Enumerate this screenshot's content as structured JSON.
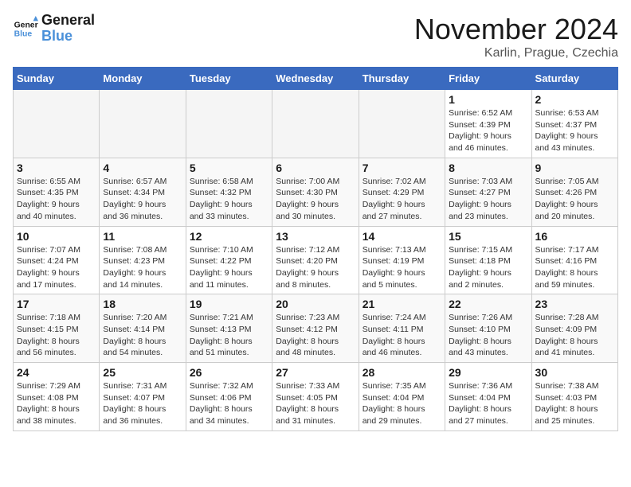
{
  "logo": {
    "line1": "General",
    "line2": "Blue"
  },
  "title": "November 2024",
  "location": "Karlin, Prague, Czechia",
  "weekdays": [
    "Sunday",
    "Monday",
    "Tuesday",
    "Wednesday",
    "Thursday",
    "Friday",
    "Saturday"
  ],
  "weeks": [
    [
      {
        "day": "",
        "info": ""
      },
      {
        "day": "",
        "info": ""
      },
      {
        "day": "",
        "info": ""
      },
      {
        "day": "",
        "info": ""
      },
      {
        "day": "",
        "info": ""
      },
      {
        "day": "1",
        "info": "Sunrise: 6:52 AM\nSunset: 4:39 PM\nDaylight: 9 hours\nand 46 minutes."
      },
      {
        "day": "2",
        "info": "Sunrise: 6:53 AM\nSunset: 4:37 PM\nDaylight: 9 hours\nand 43 minutes."
      }
    ],
    [
      {
        "day": "3",
        "info": "Sunrise: 6:55 AM\nSunset: 4:35 PM\nDaylight: 9 hours\nand 40 minutes."
      },
      {
        "day": "4",
        "info": "Sunrise: 6:57 AM\nSunset: 4:34 PM\nDaylight: 9 hours\nand 36 minutes."
      },
      {
        "day": "5",
        "info": "Sunrise: 6:58 AM\nSunset: 4:32 PM\nDaylight: 9 hours\nand 33 minutes."
      },
      {
        "day": "6",
        "info": "Sunrise: 7:00 AM\nSunset: 4:30 PM\nDaylight: 9 hours\nand 30 minutes."
      },
      {
        "day": "7",
        "info": "Sunrise: 7:02 AM\nSunset: 4:29 PM\nDaylight: 9 hours\nand 27 minutes."
      },
      {
        "day": "8",
        "info": "Sunrise: 7:03 AM\nSunset: 4:27 PM\nDaylight: 9 hours\nand 23 minutes."
      },
      {
        "day": "9",
        "info": "Sunrise: 7:05 AM\nSunset: 4:26 PM\nDaylight: 9 hours\nand 20 minutes."
      }
    ],
    [
      {
        "day": "10",
        "info": "Sunrise: 7:07 AM\nSunset: 4:24 PM\nDaylight: 9 hours\nand 17 minutes."
      },
      {
        "day": "11",
        "info": "Sunrise: 7:08 AM\nSunset: 4:23 PM\nDaylight: 9 hours\nand 14 minutes."
      },
      {
        "day": "12",
        "info": "Sunrise: 7:10 AM\nSunset: 4:22 PM\nDaylight: 9 hours\nand 11 minutes."
      },
      {
        "day": "13",
        "info": "Sunrise: 7:12 AM\nSunset: 4:20 PM\nDaylight: 9 hours\nand 8 minutes."
      },
      {
        "day": "14",
        "info": "Sunrise: 7:13 AM\nSunset: 4:19 PM\nDaylight: 9 hours\nand 5 minutes."
      },
      {
        "day": "15",
        "info": "Sunrise: 7:15 AM\nSunset: 4:18 PM\nDaylight: 9 hours\nand 2 minutes."
      },
      {
        "day": "16",
        "info": "Sunrise: 7:17 AM\nSunset: 4:16 PM\nDaylight: 8 hours\nand 59 minutes."
      }
    ],
    [
      {
        "day": "17",
        "info": "Sunrise: 7:18 AM\nSunset: 4:15 PM\nDaylight: 8 hours\nand 56 minutes."
      },
      {
        "day": "18",
        "info": "Sunrise: 7:20 AM\nSunset: 4:14 PM\nDaylight: 8 hours\nand 54 minutes."
      },
      {
        "day": "19",
        "info": "Sunrise: 7:21 AM\nSunset: 4:13 PM\nDaylight: 8 hours\nand 51 minutes."
      },
      {
        "day": "20",
        "info": "Sunrise: 7:23 AM\nSunset: 4:12 PM\nDaylight: 8 hours\nand 48 minutes."
      },
      {
        "day": "21",
        "info": "Sunrise: 7:24 AM\nSunset: 4:11 PM\nDaylight: 8 hours\nand 46 minutes."
      },
      {
        "day": "22",
        "info": "Sunrise: 7:26 AM\nSunset: 4:10 PM\nDaylight: 8 hours\nand 43 minutes."
      },
      {
        "day": "23",
        "info": "Sunrise: 7:28 AM\nSunset: 4:09 PM\nDaylight: 8 hours\nand 41 minutes."
      }
    ],
    [
      {
        "day": "24",
        "info": "Sunrise: 7:29 AM\nSunset: 4:08 PM\nDaylight: 8 hours\nand 38 minutes."
      },
      {
        "day": "25",
        "info": "Sunrise: 7:31 AM\nSunset: 4:07 PM\nDaylight: 8 hours\nand 36 minutes."
      },
      {
        "day": "26",
        "info": "Sunrise: 7:32 AM\nSunset: 4:06 PM\nDaylight: 8 hours\nand 34 minutes."
      },
      {
        "day": "27",
        "info": "Sunrise: 7:33 AM\nSunset: 4:05 PM\nDaylight: 8 hours\nand 31 minutes."
      },
      {
        "day": "28",
        "info": "Sunrise: 7:35 AM\nSunset: 4:04 PM\nDaylight: 8 hours\nand 29 minutes."
      },
      {
        "day": "29",
        "info": "Sunrise: 7:36 AM\nSunset: 4:04 PM\nDaylight: 8 hours\nand 27 minutes."
      },
      {
        "day": "30",
        "info": "Sunrise: 7:38 AM\nSunset: 4:03 PM\nDaylight: 8 hours\nand 25 minutes."
      }
    ]
  ]
}
